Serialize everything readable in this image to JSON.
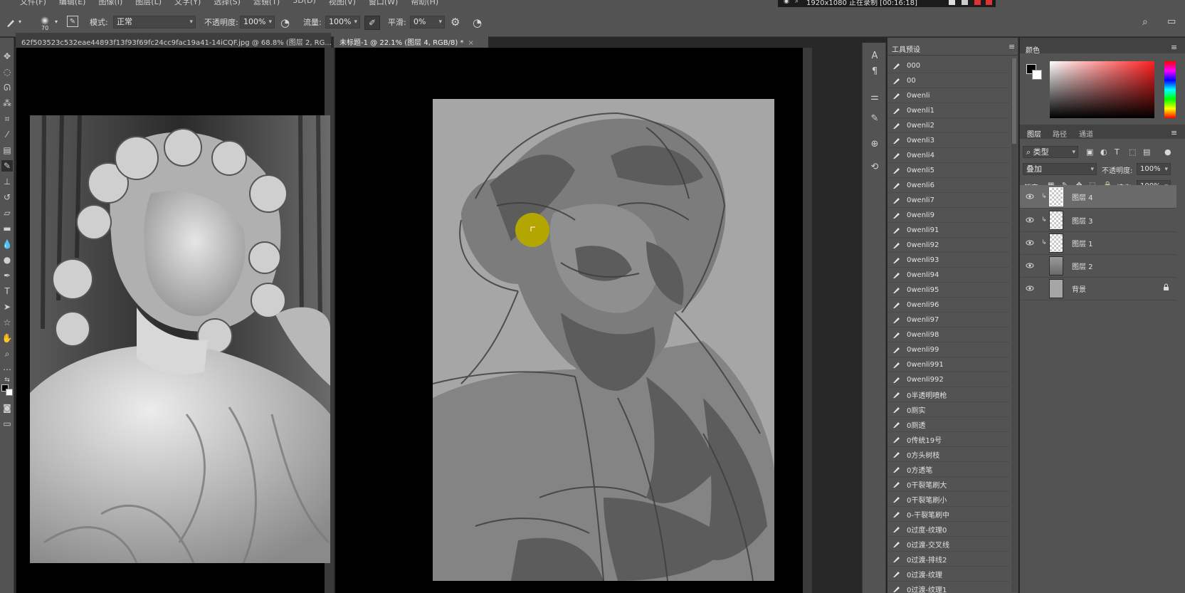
{
  "menu": {
    "items": [
      "文件(F)",
      "编辑(E)",
      "图像(I)",
      "图层(L)",
      "文字(Y)",
      "选择(S)",
      "滤镜(T)",
      "3D(D)",
      "视图(V)",
      "窗口(W)",
      "帮助(H)"
    ]
  },
  "recording": {
    "text": "1920x1080  正在录制 [00:16:18]"
  },
  "options": {
    "brush_size": "70",
    "mode_label": "模式:",
    "mode_value": "正常",
    "opacity_label": "不透明度:",
    "opacity_value": "100%",
    "flow_label": "流量:",
    "flow_value": "100%",
    "smooth_label": "平滑:",
    "smooth_value": "0%"
  },
  "tabs": [
    {
      "label": "62f503523c532eae44893f13f93f69fc24cc9fac19a41-14iCQF.jpg @ 68.8% (图层 2, RG...",
      "close": "×"
    },
    {
      "label": "未标题-1 @ 22.1% (图层 4, RGB/8) *",
      "close": "×"
    }
  ],
  "presets": {
    "title": "工具预设",
    "items": [
      "000",
      "00",
      "0wenli",
      "0wenli1",
      "0wenli2",
      "0wenli3",
      "0wenli4",
      "0wenli5",
      "0wenli6",
      "0wenli7",
      "0wenli9",
      "0wenli91",
      "0wenli92",
      "0wenli93",
      "0wenli94",
      "0wenli95",
      "0wenli96",
      "0wenli97",
      "0wenli98",
      "0wenli99",
      "0wenli991",
      "0wenli992",
      "0半透明喷枪",
      "0厕实",
      "0厕透",
      "0传统19号",
      "0方头树枝",
      "0方透笔",
      "0干裂笔刷大",
      "0干裂笔刷小",
      "0-干裂笔刷中",
      "0过度-纹理0",
      "0过渡-交叉线",
      "0过渡-排线2",
      "0过渡-纹理",
      "0过渡-纹理1"
    ]
  },
  "color_panel": {
    "title": "颜色",
    "fg": "#000000",
    "bg": "#ffffff"
  },
  "layers_panel": {
    "tabs": [
      "图层",
      "路径",
      "通道"
    ],
    "filter_label": "类型",
    "blend_mode": "叠加",
    "opacity_label": "不透明度:",
    "opacity_value": "100%",
    "lock_label": "锁定:",
    "fill_label": "填充:",
    "fill_value": "100%",
    "layers": [
      {
        "name": "图层 4",
        "clipped": true,
        "selected": true,
        "thumb": "checker"
      },
      {
        "name": "图层 3",
        "clipped": true,
        "selected": false,
        "thumb": "checker"
      },
      {
        "name": "图层 1",
        "clipped": true,
        "selected": false,
        "thumb": "checker"
      },
      {
        "name": "图层 2",
        "clipped": false,
        "selected": false,
        "thumb": "figure"
      },
      {
        "name": "背景",
        "clipped": false,
        "selected": false,
        "thumb": "gray",
        "locked": true
      }
    ]
  },
  "colors": {
    "cursor_yellow": "#b3a600",
    "panel": "#535353",
    "canvas_gray": "#a6a6a6"
  }
}
